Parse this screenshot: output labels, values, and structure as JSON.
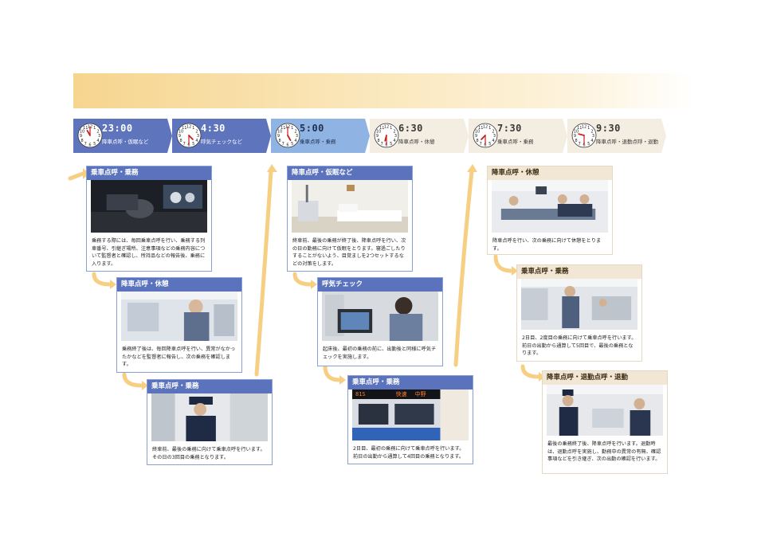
{
  "timeline": [
    {
      "time": "23:00",
      "label": "降車点呼・仮眠など",
      "style": "dark",
      "hour": 11,
      "minute": 0
    },
    {
      "time": "4:30",
      "label": "呼気チェックなど",
      "style": "dark",
      "hour": 4,
      "minute": 30
    },
    {
      "time": "5:00",
      "label": "乗車点呼・乗務",
      "style": "mid",
      "hour": 5,
      "minute": 0
    },
    {
      "time": "6:30",
      "label": "降車点呼・休憩",
      "style": "beige",
      "hour": 6,
      "minute": 30
    },
    {
      "time": "7:30",
      "label": "乗車点呼・乗務",
      "style": "beige",
      "hour": 7,
      "minute": 30
    },
    {
      "time": "9:30",
      "label": "降車点呼・退勤点呼・退勤",
      "style": "beige",
      "hour": 9,
      "minute": 30
    }
  ],
  "cards": [
    {
      "title": "乗車点呼・乗務",
      "text": "乗務する際には、毎回乗車点呼を行い、乗務する列車番号、引継ぎ場所、注意事項などの乗務内容について監督者と確認し、所持品などの報告後、乗務に入ります。"
    },
    {
      "title": "降車点呼・休憩",
      "text": "乗務終了後は、毎回降車点呼を行い、異常がなかったかなどを監督者に報告し、次の乗務を確認します。"
    },
    {
      "title": "乗車点呼・乗務",
      "text": "終車前、最後の乗務に向けて乗車点呼を行います。その日の3回目の乗務となります。"
    },
    {
      "title": "降車点呼・仮眠など",
      "text": "終車前、最後の乗務が終了後、降車点呼を行い、次の日の勤務に向けて仮眠をとります。寝過ごしたりすることがないよう、目覚ましを2つセットするなどの対策をします。"
    },
    {
      "title": "呼気チェック",
      "text": "起床後、最初の乗務の前に、出勤後と同様に呼気チェックを実施します。"
    },
    {
      "title": "乗車点呼・乗務",
      "text": "2日目、最初の乗務に向けて乗車点呼を行います。前日の出勤から通算して4回目の乗務となります。",
      "sign_number": "81S",
      "sign_type": "快速",
      "sign_dest": "中野"
    },
    {
      "title": "降車点呼・休憩",
      "text": "降車点呼を行い、次の乗務に向けて休憩をとります。"
    },
    {
      "title": "乗車点呼・乗務",
      "text": "2日目、2度目の乗務に向けて乗車点呼を行います。前日の出勤から通算して5回目で、最後の乗務となります。"
    },
    {
      "title": "降車点呼・退勤点呼・退勤",
      "text": "最後の乗務終了後、降車点呼を行います。退勤時は、退勤点呼を実施し、勤務中の異常の有無、確認事項などを引き継ぎ、次の出勤の確認を行います。"
    }
  ],
  "colors": {
    "dark": "#5e74bd",
    "mid": "#8fb3e2",
    "beige": "#f4ede1",
    "arrow": "#f7cf83",
    "banner": "#f6d58e"
  }
}
